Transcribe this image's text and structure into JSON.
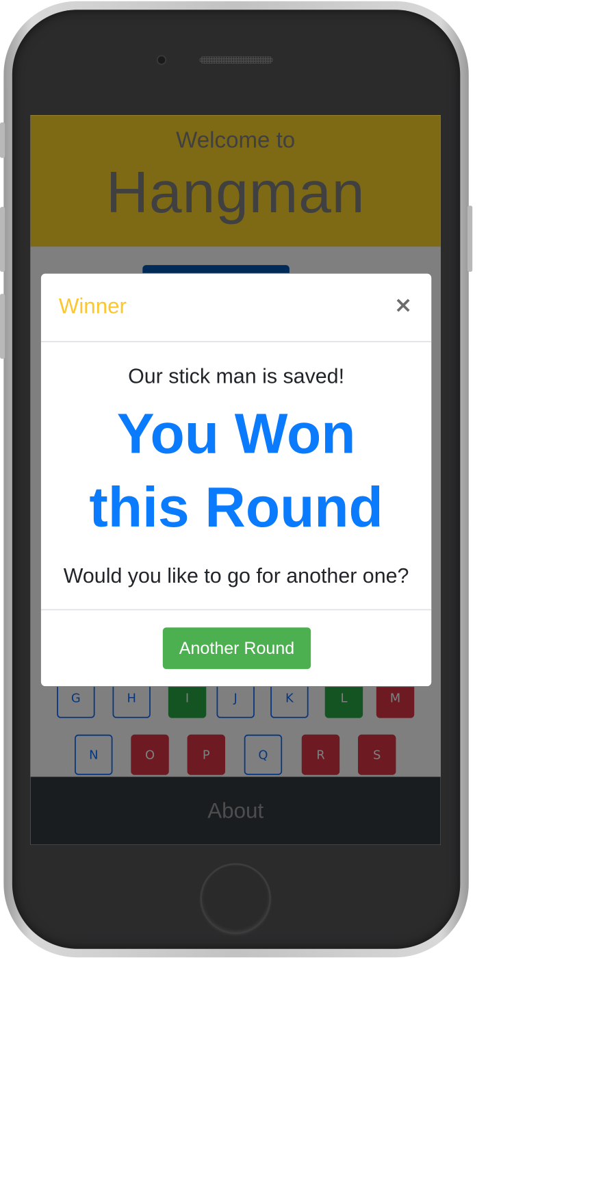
{
  "header": {
    "subtitle": "Welcome to",
    "title": "Hangman"
  },
  "keyboard": {
    "row1": [
      {
        "letter": "G",
        "state": "unused"
      },
      {
        "letter": "H",
        "state": "unused"
      },
      {
        "letter": "I",
        "state": "correct"
      },
      {
        "letter": "J",
        "state": "unused"
      },
      {
        "letter": "K",
        "state": "unused"
      },
      {
        "letter": "L",
        "state": "correct"
      },
      {
        "letter": "M",
        "state": "wrong"
      }
    ],
    "row2": [
      {
        "letter": "N",
        "state": "unused"
      },
      {
        "letter": "O",
        "state": "wrong"
      },
      {
        "letter": "P",
        "state": "wrong"
      },
      {
        "letter": "Q",
        "state": "unused"
      },
      {
        "letter": "R",
        "state": "wrong"
      },
      {
        "letter": "S",
        "state": "wrong"
      }
    ]
  },
  "footer": {
    "link": "About"
  },
  "modal": {
    "title": "Winner",
    "close_symbol": "×",
    "message": "Our stick man is saved!",
    "headline_line1": "You Won",
    "headline_line2": "this Round",
    "question": "Would you like to go for another one?",
    "button_label": "Another Round"
  },
  "colors": {
    "hero_bg": "#fdd22a",
    "modal_title": "#fcc62f",
    "headline": "#0b7bfd",
    "button_bg": "#4caf50",
    "footer_bg": "#343a40"
  }
}
